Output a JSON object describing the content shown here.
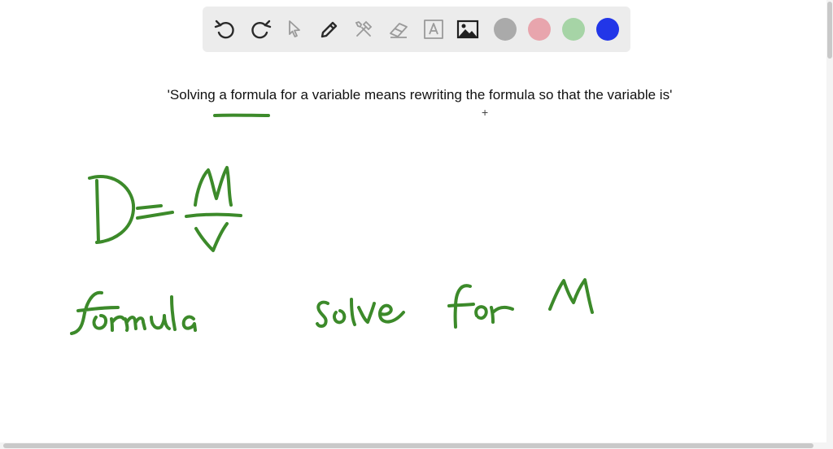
{
  "toolbar": {
    "tools": [
      "undo-icon",
      "redo-icon",
      "select-pointer-icon",
      "pen-icon",
      "tools-icon",
      "eraser-icon",
      "text-box-icon",
      "image-icon"
    ],
    "colors": [
      {
        "name": "gray",
        "hex": "#aaaaaa"
      },
      {
        "name": "pink",
        "hex": "#e8a5ad"
      },
      {
        "name": "light-green",
        "hex": "#a6d4a6"
      },
      {
        "name": "blue",
        "hex": "#2236e8"
      }
    ]
  },
  "canvas": {
    "prompt_text": "'Solving a formula for a variable means rewriting the formula so that the variable is'",
    "cursor_glyph": "+",
    "ink_color": "#3c8a2a",
    "handwriting": [
      "D = M/V",
      "formula",
      "solve for M"
    ]
  }
}
